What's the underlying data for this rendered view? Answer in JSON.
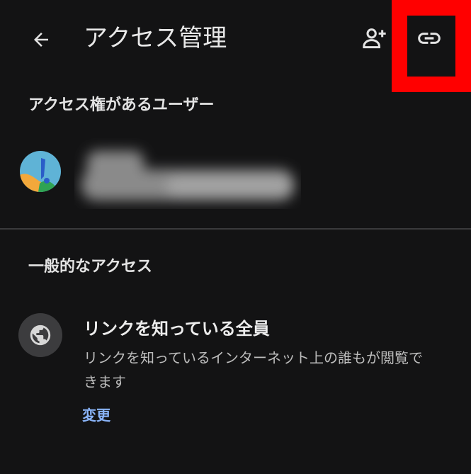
{
  "header": {
    "title": "アクセス管理",
    "back_icon": "arrow-left-icon",
    "add_person_icon": "person-add-icon",
    "link_icon": "link-icon"
  },
  "users_section": {
    "heading": "アクセス権があるユーザー"
  },
  "general_section": {
    "heading": "一般的なアクセス",
    "access_title": "リンクを知っている全員",
    "access_description": "リンクを知っているインターネット上の誰もが閲覧できます",
    "change_label": "変更",
    "globe_icon": "globe-icon"
  },
  "colors": {
    "background": "#131314",
    "highlight": "#ff0000",
    "link_text": "#8ab4f8"
  }
}
